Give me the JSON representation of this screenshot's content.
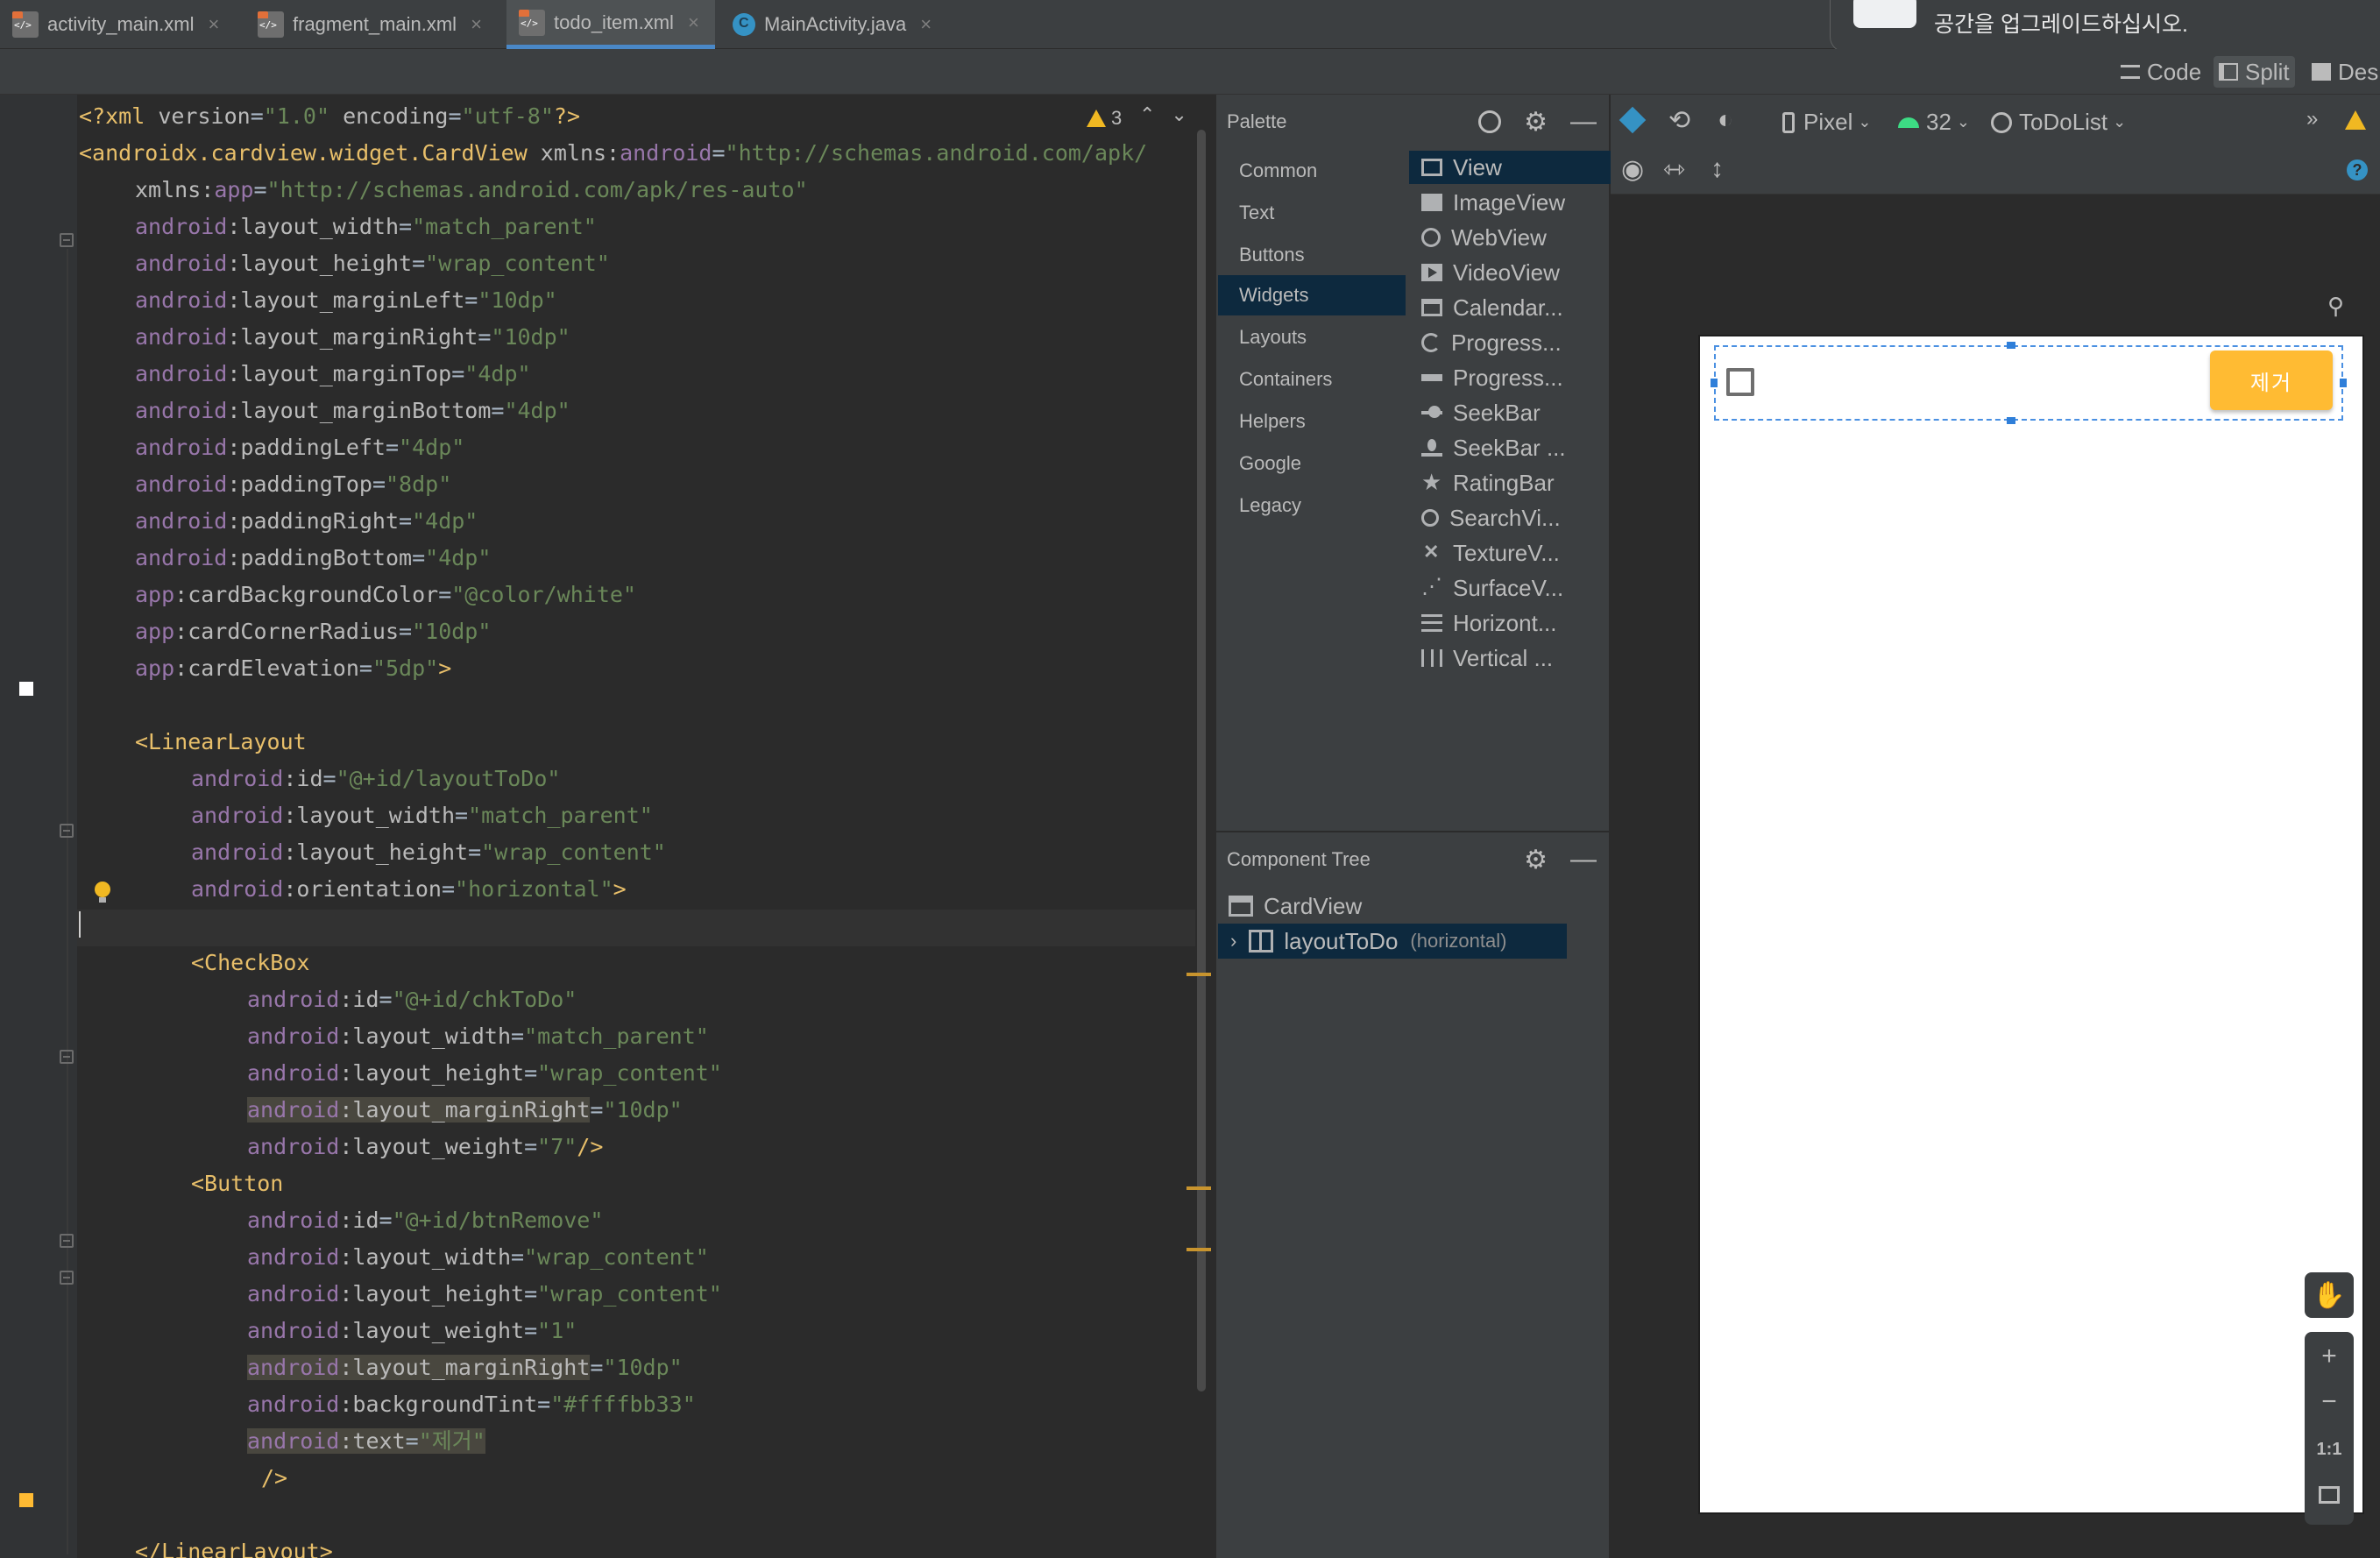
{
  "tabs": [
    {
      "label": "activity_main.xml",
      "icon": "xml-file-icon"
    },
    {
      "label": "fragment_main.xml",
      "icon": "xml-file-icon"
    },
    {
      "label": "todo_item.xml",
      "icon": "xml-file-icon",
      "active": true
    },
    {
      "label": "MainActivity.java",
      "icon": "java-class-icon"
    }
  ],
  "notification": {
    "text": "공간을 업그레이드하십시오."
  },
  "view_modes": [
    {
      "label": "Code"
    },
    {
      "label": "Split",
      "active": true
    },
    {
      "label": "Des"
    }
  ],
  "editor": {
    "warning_count": "3",
    "accent_colors": {
      "tag": "#e8bf6a",
      "namespace": "#9876aa",
      "value": "#6a8759",
      "warning": "#f0b822"
    }
  },
  "code": {
    "l1": {
      "open": "<?",
      "tag": "xml",
      "a1": " version",
      "v1": "\"1.0\"",
      "a2": " encoding",
      "v2": "\"utf-8\"",
      "close": "?>"
    },
    "l2": {
      "tag": "<androidx.cardview.widget.CardView",
      "attr": " xmlns:",
      "ns": "android",
      "val": "\"http://schemas.android.com/apk/"
    },
    "l3": {
      "attr": "xmlns:",
      "ns": "app",
      "val": "\"http://schemas.android.com/apk/res-auto\""
    },
    "l4": {
      "ns": "android",
      "attr": ":layout_width",
      "val": "\"match_parent\""
    },
    "l5": {
      "ns": "android",
      "attr": ":layout_height",
      "val": "\"wrap_content\""
    },
    "l6": {
      "ns": "android",
      "attr": ":layout_marginLeft",
      "val": "\"10dp\""
    },
    "l7": {
      "ns": "android",
      "attr": ":layout_marginRight",
      "val": "\"10dp\""
    },
    "l8": {
      "ns": "android",
      "attr": ":layout_marginTop",
      "val": "\"4dp\""
    },
    "l9": {
      "ns": "android",
      "attr": ":layout_marginBottom",
      "val": "\"4dp\""
    },
    "l10": {
      "ns": "android",
      "attr": ":paddingLeft",
      "val": "\"4dp\""
    },
    "l11": {
      "ns": "android",
      "attr": ":paddingTop",
      "val": "\"8dp\""
    },
    "l12": {
      "ns": "android",
      "attr": ":paddingRight",
      "val": "\"4dp\""
    },
    "l13": {
      "ns": "android",
      "attr": ":paddingBottom",
      "val": "\"4dp\""
    },
    "l14": {
      "ns": "app",
      "attr": ":cardBackgroundColor",
      "val": "\"@color/white\""
    },
    "l15": {
      "ns": "app",
      "attr": ":cardCornerRadius",
      "val": "\"10dp\""
    },
    "l16": {
      "ns": "app",
      "attr": ":cardElevation",
      "val": "\"5dp\"",
      "close": ">"
    },
    "l18": {
      "tag": "<LinearLayout"
    },
    "l19": {
      "ns": "android",
      "attr": ":id",
      "val": "\"@+id/layoutToDo\""
    },
    "l20": {
      "ns": "android",
      "attr": ":layout_width",
      "val": "\"match_parent\""
    },
    "l21": {
      "ns": "android",
      "attr": ":layout_height",
      "val": "\"wrap_content\""
    },
    "l22": {
      "ns": "android",
      "attr": ":orientation",
      "val": "\"horizontal\"",
      "close": ">"
    },
    "l24": {
      "tag": "<CheckBox"
    },
    "l25": {
      "ns": "android",
      "attr": ":id",
      "val": "\"@+id/chkToDo\""
    },
    "l26": {
      "ns": "android",
      "attr": ":layout_width",
      "val": "\"match_parent\""
    },
    "l27": {
      "ns": "android",
      "attr": ":layout_height",
      "val": "\"wrap_content\""
    },
    "l28": {
      "ns": "android",
      "attr": ":layout_marginRight",
      "val": "\"10dp\""
    },
    "l29": {
      "ns": "android",
      "attr": ":layout_weight",
      "val": "\"7\"",
      "close": "/>"
    },
    "l30": {
      "tag": "<Button"
    },
    "l31": {
      "ns": "android",
      "attr": ":id",
      "val": "\"@+id/btnRemove\""
    },
    "l32": {
      "ns": "android",
      "attr": ":layout_width",
      "val": "\"wrap_content\""
    },
    "l33": {
      "ns": "android",
      "attr": ":layout_height",
      "val": "\"wrap_content\""
    },
    "l34": {
      "ns": "android",
      "attr": ":layout_weight",
      "val": "\"1\""
    },
    "l35": {
      "ns": "android",
      "attr": ":layout_marginRight",
      "val": "\"10dp\""
    },
    "l36": {
      "ns": "android",
      "attr": ":backgroundTint",
      "val": "\"#ffffbb33\""
    },
    "l37": {
      "ns": "android",
      "attr": ":text",
      "val": "\"제거\""
    },
    "l38": {
      "close": "/>"
    },
    "l40": {
      "tag": "</LinearLayout>"
    }
  },
  "palette": {
    "title": "Palette",
    "categories": [
      "Common",
      "Text",
      "Buttons",
      "Widgets",
      "Layouts",
      "Containers",
      "Helpers",
      "Google",
      "Legacy"
    ],
    "selected_category": "Widgets",
    "items": [
      {
        "label": "View",
        "icon": "view-icon"
      },
      {
        "label": "ImageView",
        "icon": "image-icon"
      },
      {
        "label": "WebView",
        "icon": "globe-icon"
      },
      {
        "label": "VideoView",
        "icon": "video-icon"
      },
      {
        "label": "Calendar...",
        "icon": "calendar-icon"
      },
      {
        "label": "Progress...",
        "icon": "progress-ring-icon"
      },
      {
        "label": "Progress...",
        "icon": "progress-bar-icon"
      },
      {
        "label": "SeekBar",
        "icon": "seekbar-icon"
      },
      {
        "label": "SeekBar ...",
        "icon": "seekbar-discrete-icon"
      },
      {
        "label": "RatingBar",
        "icon": "star-icon"
      },
      {
        "label": "SearchVi...",
        "icon": "search-icon"
      },
      {
        "label": "TextureV...",
        "icon": "texture-icon"
      },
      {
        "label": "SurfaceV...",
        "icon": "surface-icon"
      },
      {
        "label": "Horizont...",
        "icon": "horizontal-divider-icon"
      },
      {
        "label": "Vertical ...",
        "icon": "vertical-divider-icon"
      }
    ]
  },
  "component_tree": {
    "title": "Component Tree",
    "root": "CardView",
    "child": {
      "label": "layoutToDo",
      "hint": "(horizontal)"
    }
  },
  "design": {
    "device": "Pixel",
    "api": "32",
    "theme": "ToDoList",
    "remove_button_label": "제거",
    "button_tint": "#ffbb33",
    "zoom_actual_label": "1:1"
  }
}
